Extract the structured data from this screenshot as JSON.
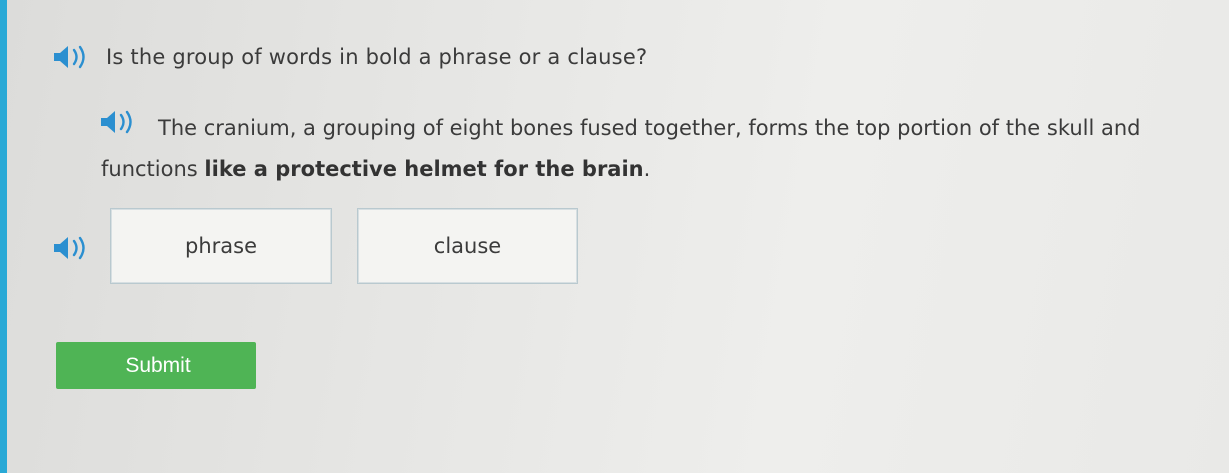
{
  "question": {
    "text": "Is the group of words in bold a phrase or a clause?",
    "audio_icon": "speaker-icon"
  },
  "sentence": {
    "plain": "The cranium, a grouping of eight bones fused together, forms the top portion of the skull and functions",
    "bold": "like a protective helmet for the brain",
    "end": ".",
    "audio_icon": "speaker-icon"
  },
  "choices": {
    "audio_icon": "speaker-icon",
    "items": [
      {
        "label": "phrase"
      },
      {
        "label": "clause"
      }
    ]
  },
  "submit": {
    "label": "Submit"
  },
  "colors": {
    "accent_bar": "#29a9d6",
    "speaker": "#2b8fd0",
    "submit": "#4fb455"
  }
}
